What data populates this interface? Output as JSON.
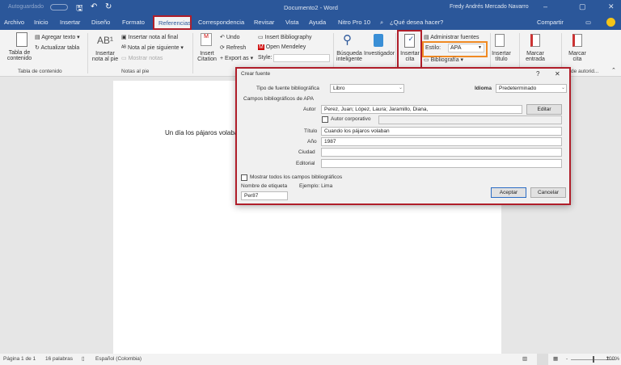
{
  "titlebar": {
    "autosave": "Autoguardado",
    "doc_title": "Documento2 - Word",
    "user": "Fredy Andrés Mercado Navarro"
  },
  "tabs": [
    "Archivo",
    "Inicio",
    "Insertar",
    "Diseño",
    "Formato",
    "Referencias",
    "Correspondencia",
    "Revisar",
    "Vista",
    "Ayuda",
    "Nitro Pro 10"
  ],
  "search": "¿Qué desea hacer?",
  "share": "Compartir",
  "ribbon": {
    "toc": {
      "button": "Tabla de contenido",
      "add_text": "Agregar texto",
      "update_table": "Actualizar tabla",
      "group": "Tabla de contenido"
    },
    "footnotes": {
      "insert": "Insertar nota al pie",
      "endnote": "Insertar nota al final",
      "next": "Nota al pie siguiente",
      "show": "Mostrar notas",
      "group": "Notas al pie"
    },
    "mendeley": {
      "insert_citation": "Insert Citation",
      "undo": "Undo",
      "refresh": "Refresh",
      "export": "Export as",
      "insert_bib": "Insert Bibliography",
      "open": "Open Mendeley",
      "style": "Style:"
    },
    "research": {
      "smart": "Búsqueda inteligente",
      "researcher": "Investigador"
    },
    "citations": {
      "insert": "Insertar cita",
      "manage": "Administrar fuentes",
      "style_label": "Estilo:",
      "style_value": "APA",
      "bibliography": "Bibliografía"
    },
    "captions": {
      "insert": "Insertar título"
    },
    "index": {
      "mark": "Marcar entrada"
    },
    "toa": {
      "mark": "Marcar cita",
      "group": "de autorid..."
    }
  },
  "document": {
    "text": "Un día los pájaros volaban"
  },
  "dialog": {
    "title": "Crear fuente",
    "help": "?",
    "close": "✕",
    "type_label": "Tipo de fuente bibliográfica",
    "type_value": "Libro",
    "lang_label": "Idioma",
    "lang_value": "Predeterminado",
    "section": "Campos bibliográficos de APA",
    "author_label": "Autor",
    "author_value": "Perez, Juan; López, Laura; Jaramillo, Diana,",
    "edit": "Editar",
    "corporate": "Autor corporativo",
    "title_label": "Título",
    "title_value": "Cuando los pájaros volaban",
    "year_label": "Año",
    "year_value": "1987",
    "city_label": "Ciudad",
    "city_value": "",
    "publisher_label": "Editorial",
    "publisher_value": "",
    "show_all": "Mostrar todos los campos bibliográficos",
    "tag_label": "Nombre de etiqueta",
    "tag_value": "Per87",
    "example": "Ejemplo: Lima",
    "ok": "Aceptar",
    "cancel": "Cancelar"
  },
  "status": {
    "page": "Página 1 de 1",
    "words": "16 palabras",
    "language": "Español (Colombia)",
    "zoom": "100%"
  }
}
